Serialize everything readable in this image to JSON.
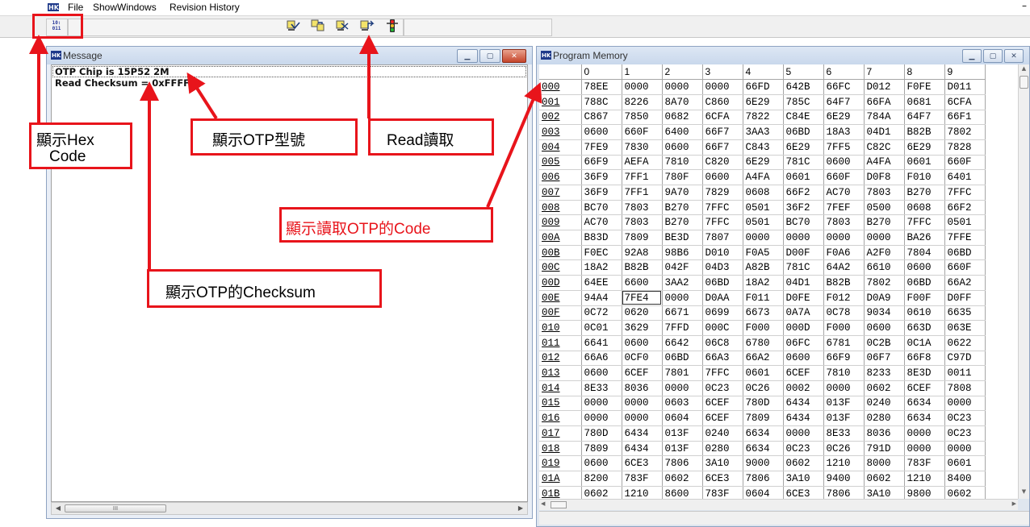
{
  "menu": {
    "items": [
      "File",
      "ShowWindows",
      "Revision History"
    ],
    "minimize": "–"
  },
  "toolbar": {
    "hex_button_lines": [
      "10:",
      "011"
    ],
    "icons": [
      "chip-read-icon",
      "chip-copy-icon",
      "chip-verify-icon",
      "chip-write-icon",
      "traffic-light-icon"
    ]
  },
  "message_window": {
    "title": "Message",
    "lines": [
      "OTP Chip is 15P52 2M",
      "Read Checksum = 0xFFFF"
    ],
    "scroll_thumb": "III"
  },
  "program_memory": {
    "title": "Program Memory",
    "columns": [
      "",
      "0",
      "1",
      "2",
      "3",
      "4",
      "5",
      "6",
      "7",
      "8",
      "9"
    ],
    "rows": [
      [
        "000",
        "78EE",
        "0000",
        "0000",
        "0000",
        "66FD",
        "642B",
        "66FC",
        "D012",
        "F0FE",
        "D011"
      ],
      [
        "001",
        "788C",
        "8226",
        "8A70",
        "C860",
        "6E29",
        "785C",
        "64F7",
        "66FA",
        "0681",
        "6CFA"
      ],
      [
        "002",
        "C867",
        "7850",
        "0682",
        "6CFA",
        "7822",
        "C84E",
        "6E29",
        "784A",
        "64F7",
        "66F1"
      ],
      [
        "003",
        "0600",
        "660F",
        "6400",
        "66F7",
        "3AA3",
        "06BD",
        "18A3",
        "04D1",
        "B82B",
        "7802"
      ],
      [
        "004",
        "7FE9",
        "7830",
        "0600",
        "66F7",
        "C843",
        "6E29",
        "7FF5",
        "C82C",
        "6E29",
        "7828"
      ],
      [
        "005",
        "66F9",
        "AEFA",
        "7810",
        "C820",
        "6E29",
        "781C",
        "0600",
        "A4FA",
        "0601",
        "660F"
      ],
      [
        "006",
        "36F9",
        "7FF1",
        "780F",
        "0600",
        "A4FA",
        "0601",
        "660F",
        "D0F8",
        "F010",
        "6401"
      ],
      [
        "007",
        "36F9",
        "7FF1",
        "9A70",
        "7829",
        "0608",
        "66F2",
        "AC70",
        "7803",
        "B270",
        "7FFC"
      ],
      [
        "008",
        "BC70",
        "7803",
        "B270",
        "7FFC",
        "0501",
        "36F2",
        "7FEF",
        "0500",
        "0608",
        "66F2"
      ],
      [
        "009",
        "AC70",
        "7803",
        "B270",
        "7FFC",
        "0501",
        "BC70",
        "7803",
        "B270",
        "7FFC",
        "0501"
      ],
      [
        "00A",
        "B83D",
        "7809",
        "BE3D",
        "7807",
        "0000",
        "0000",
        "0000",
        "0000",
        "BA26",
        "7FFE"
      ],
      [
        "00B",
        "F0EC",
        "92A8",
        "98B6",
        "D010",
        "F0A5",
        "D00F",
        "F0A6",
        "A2F0",
        "7804",
        "06BD"
      ],
      [
        "00C",
        "18A2",
        "B82B",
        "042F",
        "04D3",
        "A82B",
        "781C",
        "64A2",
        "6610",
        "0600",
        "660F"
      ],
      [
        "00D",
        "64EE",
        "6600",
        "3AA2",
        "06BD",
        "18A2",
        "04D1",
        "B82B",
        "7802",
        "06BD",
        "66A2"
      ],
      [
        "00E",
        "94A4",
        "7FE4",
        "0000",
        "D0AA",
        "F011",
        "D0FE",
        "F012",
        "D0A9",
        "F00F",
        "D0FF"
      ],
      [
        "00F",
        "0C72",
        "0620",
        "6671",
        "0699",
        "6673",
        "0A7A",
        "0C78",
        "9034",
        "0610",
        "6635"
      ],
      [
        "010",
        "0C01",
        "3629",
        "7FFD",
        "000C",
        "F000",
        "000D",
        "F000",
        "0600",
        "663D",
        "063E"
      ],
      [
        "011",
        "6641",
        "0600",
        "6642",
        "06C8",
        "6780",
        "06FC",
        "6781",
        "0C2B",
        "0C1A",
        "0622"
      ],
      [
        "012",
        "66A6",
        "0CF0",
        "06BD",
        "66A3",
        "66A2",
        "0600",
        "66F9",
        "06F7",
        "66F8",
        "C97D"
      ],
      [
        "013",
        "0600",
        "6CEF",
        "7801",
        "7FFC",
        "0601",
        "6CEF",
        "7810",
        "8233",
        "8E3D",
        "0011"
      ],
      [
        "014",
        "8E33",
        "8036",
        "0000",
        "0C23",
        "0C26",
        "0002",
        "0000",
        "0602",
        "6CEF",
        "7808"
      ],
      [
        "015",
        "0000",
        "0000",
        "0603",
        "6CEF",
        "780D",
        "6434",
        "013F",
        "0240",
        "6634",
        "0000"
      ],
      [
        "016",
        "0000",
        "0000",
        "0604",
        "6CEF",
        "7809",
        "6434",
        "013F",
        "0280",
        "6634",
        "0C23"
      ],
      [
        "017",
        "780D",
        "6434",
        "013F",
        "0240",
        "6634",
        "0000",
        "8E33",
        "8036",
        "0000",
        "0C23"
      ],
      [
        "018",
        "7809",
        "6434",
        "013F",
        "0280",
        "6634",
        "0C23",
        "0C26",
        "791D",
        "0000",
        "0000"
      ],
      [
        "019",
        "0600",
        "6CE3",
        "7806",
        "3A10",
        "9000",
        "0602",
        "1210",
        "8000",
        "783F",
        "0601"
      ],
      [
        "01A",
        "8200",
        "783F",
        "0602",
        "6CE3",
        "7806",
        "3A10",
        "9400",
        "0602",
        "1210",
        "8400"
      ],
      [
        "01B",
        "0602",
        "1210",
        "8600",
        "783F",
        "0604",
        "6CE3",
        "7806",
        "3A10",
        "9800",
        "0602"
      ]
    ]
  },
  "annotations": {
    "hex_code": [
      "顯示Hex",
      "Code"
    ],
    "otp_model": "顯示OTP型號",
    "read": "Read讀取",
    "otp_code": "顯示讀取OTP的Code",
    "otp_checksum": "顯示OTP的Checksum"
  },
  "colors": {
    "annotation_red": "#e8141b",
    "annotation_red_text": "#e8141b",
    "title_bar": "#c9d8ec"
  }
}
